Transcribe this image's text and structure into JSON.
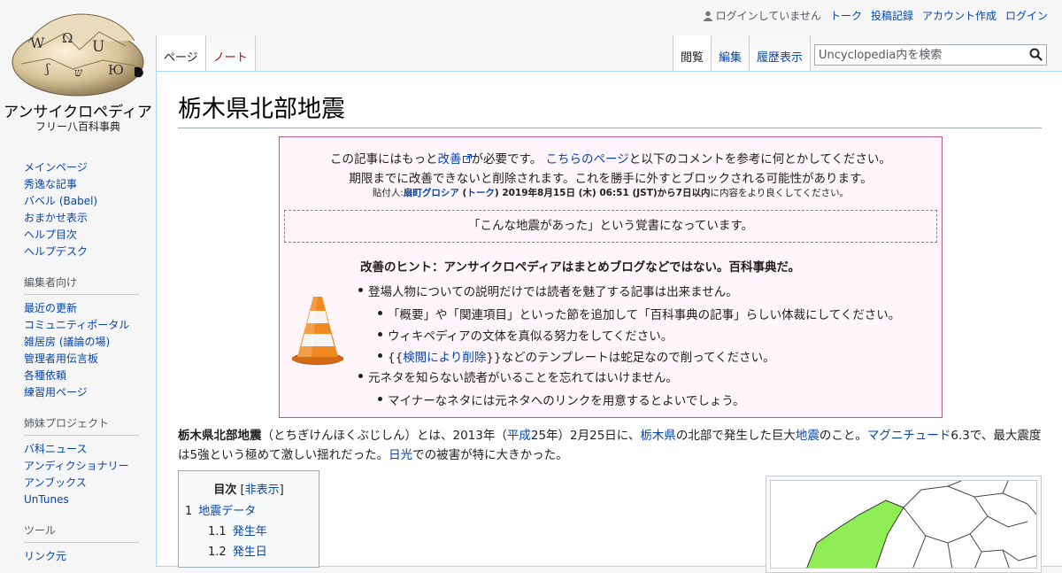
{
  "site": {
    "name": "アンサイクロペディア",
    "tagline": "フリー八百科事典"
  },
  "personal": {
    "anon": "ログインしていません",
    "items": [
      "トーク",
      "投稿記録",
      "アカウント作成",
      "ログイン"
    ]
  },
  "tabs": {
    "page": "ページ",
    "talk": "ノート",
    "read": "閲覧",
    "edit": "編集",
    "history": "履歴表示"
  },
  "search": {
    "placeholder": "Uncyclopedia内を検索"
  },
  "sidebar": {
    "nav": [
      "メインページ",
      "秀逸な記事",
      "バベル (Babel)",
      "おまかせ表示",
      "ヘルプ目次",
      "ヘルプデスク"
    ],
    "editors": {
      "title": "編集者向け",
      "items": [
        "最近の更新",
        "コミュニティポータル",
        "雑居房 (議論の場)",
        "管理者用伝言板",
        "各種依頼",
        "練習用ページ"
      ]
    },
    "sisters": {
      "title": "姉妹プロジェクト",
      "items": [
        "バ科ニュース",
        "アンディクショナリー",
        "アンブックス",
        "UnTunes"
      ]
    },
    "tools": {
      "title": "ツール",
      "items": [
        "リンク元"
      ]
    }
  },
  "article": {
    "title": "栃木県北部地震"
  },
  "ambox": {
    "line1_pre": "この記事にはもっと",
    "line1_link": "改善",
    "line1_mid": "が必要です。",
    "line1_link2": "こちらのページ",
    "line1_post": "と以下のコメントを参考に何とかしてください。",
    "line2": "期限までに改善できないと削除されます。これを勝手に外すとブロックされる可能性があります。",
    "sig_pre": "貼付人:",
    "sig_user": "扇町グロシア",
    "sig_open": " (",
    "sig_talk": "トーク",
    "sig_date": ") 2019年8月15日 (木) 06:51 (JST)から7日以内",
    "sig_post": "に内容をより良くしてください。",
    "comment": "「こんな地震があった」という覚書になっています。",
    "hint_title": "改善のヒント：アンサイクロペディアはまとめブログなどではない。百科事典だ。",
    "hint1": "登場人物についての説明だけでは読者を魅了する記事は出来ません。",
    "hint1a": "「概要」や「関連項目」といった節を追加して「百科事典の記事」らしい体裁にしてください。",
    "hint1b": "ウィキペディアの文体を真似る努力をしてください。",
    "hint1c_pre": "{{",
    "hint1c_link": "検閲により削除",
    "hint1c_post": "}}などのテンプレートは蛇足なので削ってください。",
    "hint2": "元ネタを知らない読者がいることを忘れてはいけません。",
    "hint2a": "マイナーなネタには元ネタへのリンクを用意するとよいでしょう。"
  },
  "intro": {
    "bold": "栃木県北部地震",
    "t1": "（とちぎけんほくぶじしん）とは、2013年（",
    "l1": "平成",
    "t2": "25年）2月25日に、",
    "l2": "栃木県",
    "t3": "の北部で発生した巨大",
    "l3": "地震",
    "t4": "のこと。",
    "l4": "マグニチュード",
    "t5": "6.3で、最大震度は5強という極めて激しい揺れだった。",
    "l5": "日光",
    "t6": "での被害が特に大きかった。"
  },
  "toc": {
    "title": "目次",
    "bracket_open": "[",
    "hide": "非表示",
    "bracket_close": "]",
    "items": [
      {
        "num": "1",
        "label": "地震データ"
      },
      {
        "num": "1.1",
        "label": "発生年"
      },
      {
        "num": "1.2",
        "label": "発生日"
      }
    ]
  },
  "colors": {
    "link": "#0645ad",
    "redlink": "#ba0000",
    "ambox_border": "#b8598f",
    "ambox_bg": "#fff5fa",
    "map_highlight": "#90ee55"
  }
}
